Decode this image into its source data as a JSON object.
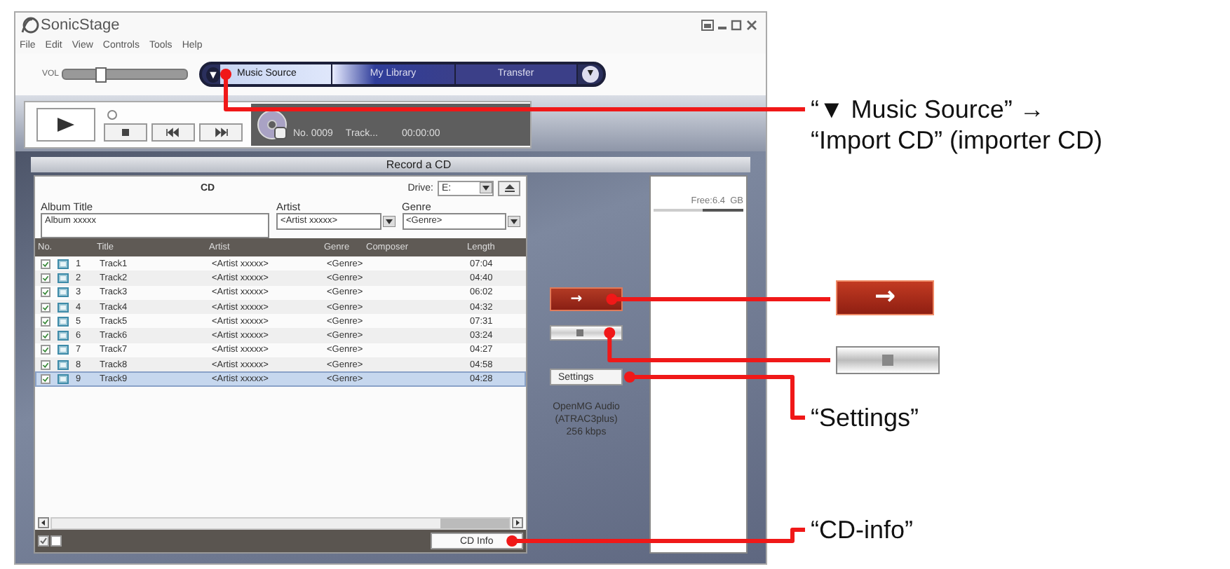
{
  "window": {
    "title": "SonicStage",
    "menu": [
      "File",
      "Edit",
      "View",
      "Controls",
      "Tools",
      "Help"
    ]
  },
  "toolbar": {
    "volume": {
      "label": "VOL",
      "level": 0.3
    },
    "dropdown_mark": "▼",
    "nav": [
      {
        "label": "Music Source",
        "selected": true
      },
      {
        "label": "My Library",
        "selected": false
      },
      {
        "label": "Transfer",
        "selected": false
      }
    ],
    "nav_menu": "▼"
  },
  "player": {
    "track_no": "No. 0009",
    "track": "Track...",
    "time": "00:00:00"
  },
  "record_panel": {
    "title": "Record a CD",
    "source": {
      "title": "CD",
      "drive_label": "Drive:",
      "drive": "E:",
      "album_label": "Album Title",
      "album": "Album xxxxx",
      "artist_label": "Artist",
      "artist": "<Artist xxxxx>",
      "genre_label": "Genre",
      "genre": "<Genre>"
    },
    "table": {
      "columns": [
        "No.",
        "Title",
        "Artist",
        "Genre",
        "Composer",
        "Length"
      ],
      "rows": [
        {
          "checked": true,
          "selected": false,
          "no": "1",
          "title": "Track1",
          "artist": "<Artist xxxxx>",
          "genre": "<Genre>",
          "length": "07:04"
        },
        {
          "checked": true,
          "selected": false,
          "no": "2",
          "title": "Track2",
          "artist": "<Artist xxxxx>",
          "genre": "<Genre>",
          "length": "04:40"
        },
        {
          "checked": true,
          "selected": false,
          "no": "3",
          "title": "Track3",
          "artist": "<Artist xxxxx>",
          "genre": "<Genre>",
          "length": "06:02"
        },
        {
          "checked": true,
          "selected": false,
          "no": "4",
          "title": "Track4",
          "artist": "<Artist xxxxx>",
          "genre": "<Genre>",
          "length": "04:32"
        },
        {
          "checked": true,
          "selected": false,
          "no": "5",
          "title": "Track5",
          "artist": "<Artist xxxxx>",
          "genre": "<Genre>",
          "length": "07:31"
        },
        {
          "checked": true,
          "selected": false,
          "no": "6",
          "title": "Track6",
          "artist": "<Artist xxxxx>",
          "genre": "<Genre>",
          "length": "03:24"
        },
        {
          "checked": true,
          "selected": false,
          "no": "7",
          "title": "Track7",
          "artist": "<Artist xxxxx>",
          "genre": "<Genre>",
          "length": "04:27"
        },
        {
          "checked": true,
          "selected": false,
          "no": "8",
          "title": "Track8",
          "artist": "<Artist xxxxx>",
          "genre": "<Genre>",
          "length": "04:58"
        },
        {
          "checked": true,
          "selected": true,
          "no": "9",
          "title": "Track9",
          "artist": "<Artist xxxxx>",
          "genre": "<Genre>",
          "length": "04:28"
        }
      ]
    },
    "cd_info_button": "CD Info",
    "actions": {
      "import_button": "→",
      "settings_button": "Settings",
      "format": [
        "OpenMG Audio",
        "(ATRAC3plus)",
        "256 kbps"
      ]
    },
    "destination": {
      "free": "Free:6.4  GB",
      "level": 0.45
    }
  },
  "callouts": [
    {
      "kind": "text",
      "lines": [
        "“▼ Music Source” →",
        "“Import CD” (importer CD)"
      ]
    },
    {
      "kind": "import_button",
      "label": "→"
    },
    {
      "kind": "stop_button"
    },
    {
      "kind": "text",
      "lines": [
        "“Settings”"
      ]
    },
    {
      "kind": "text",
      "lines": [
        "“CD-info”"
      ]
    }
  ]
}
